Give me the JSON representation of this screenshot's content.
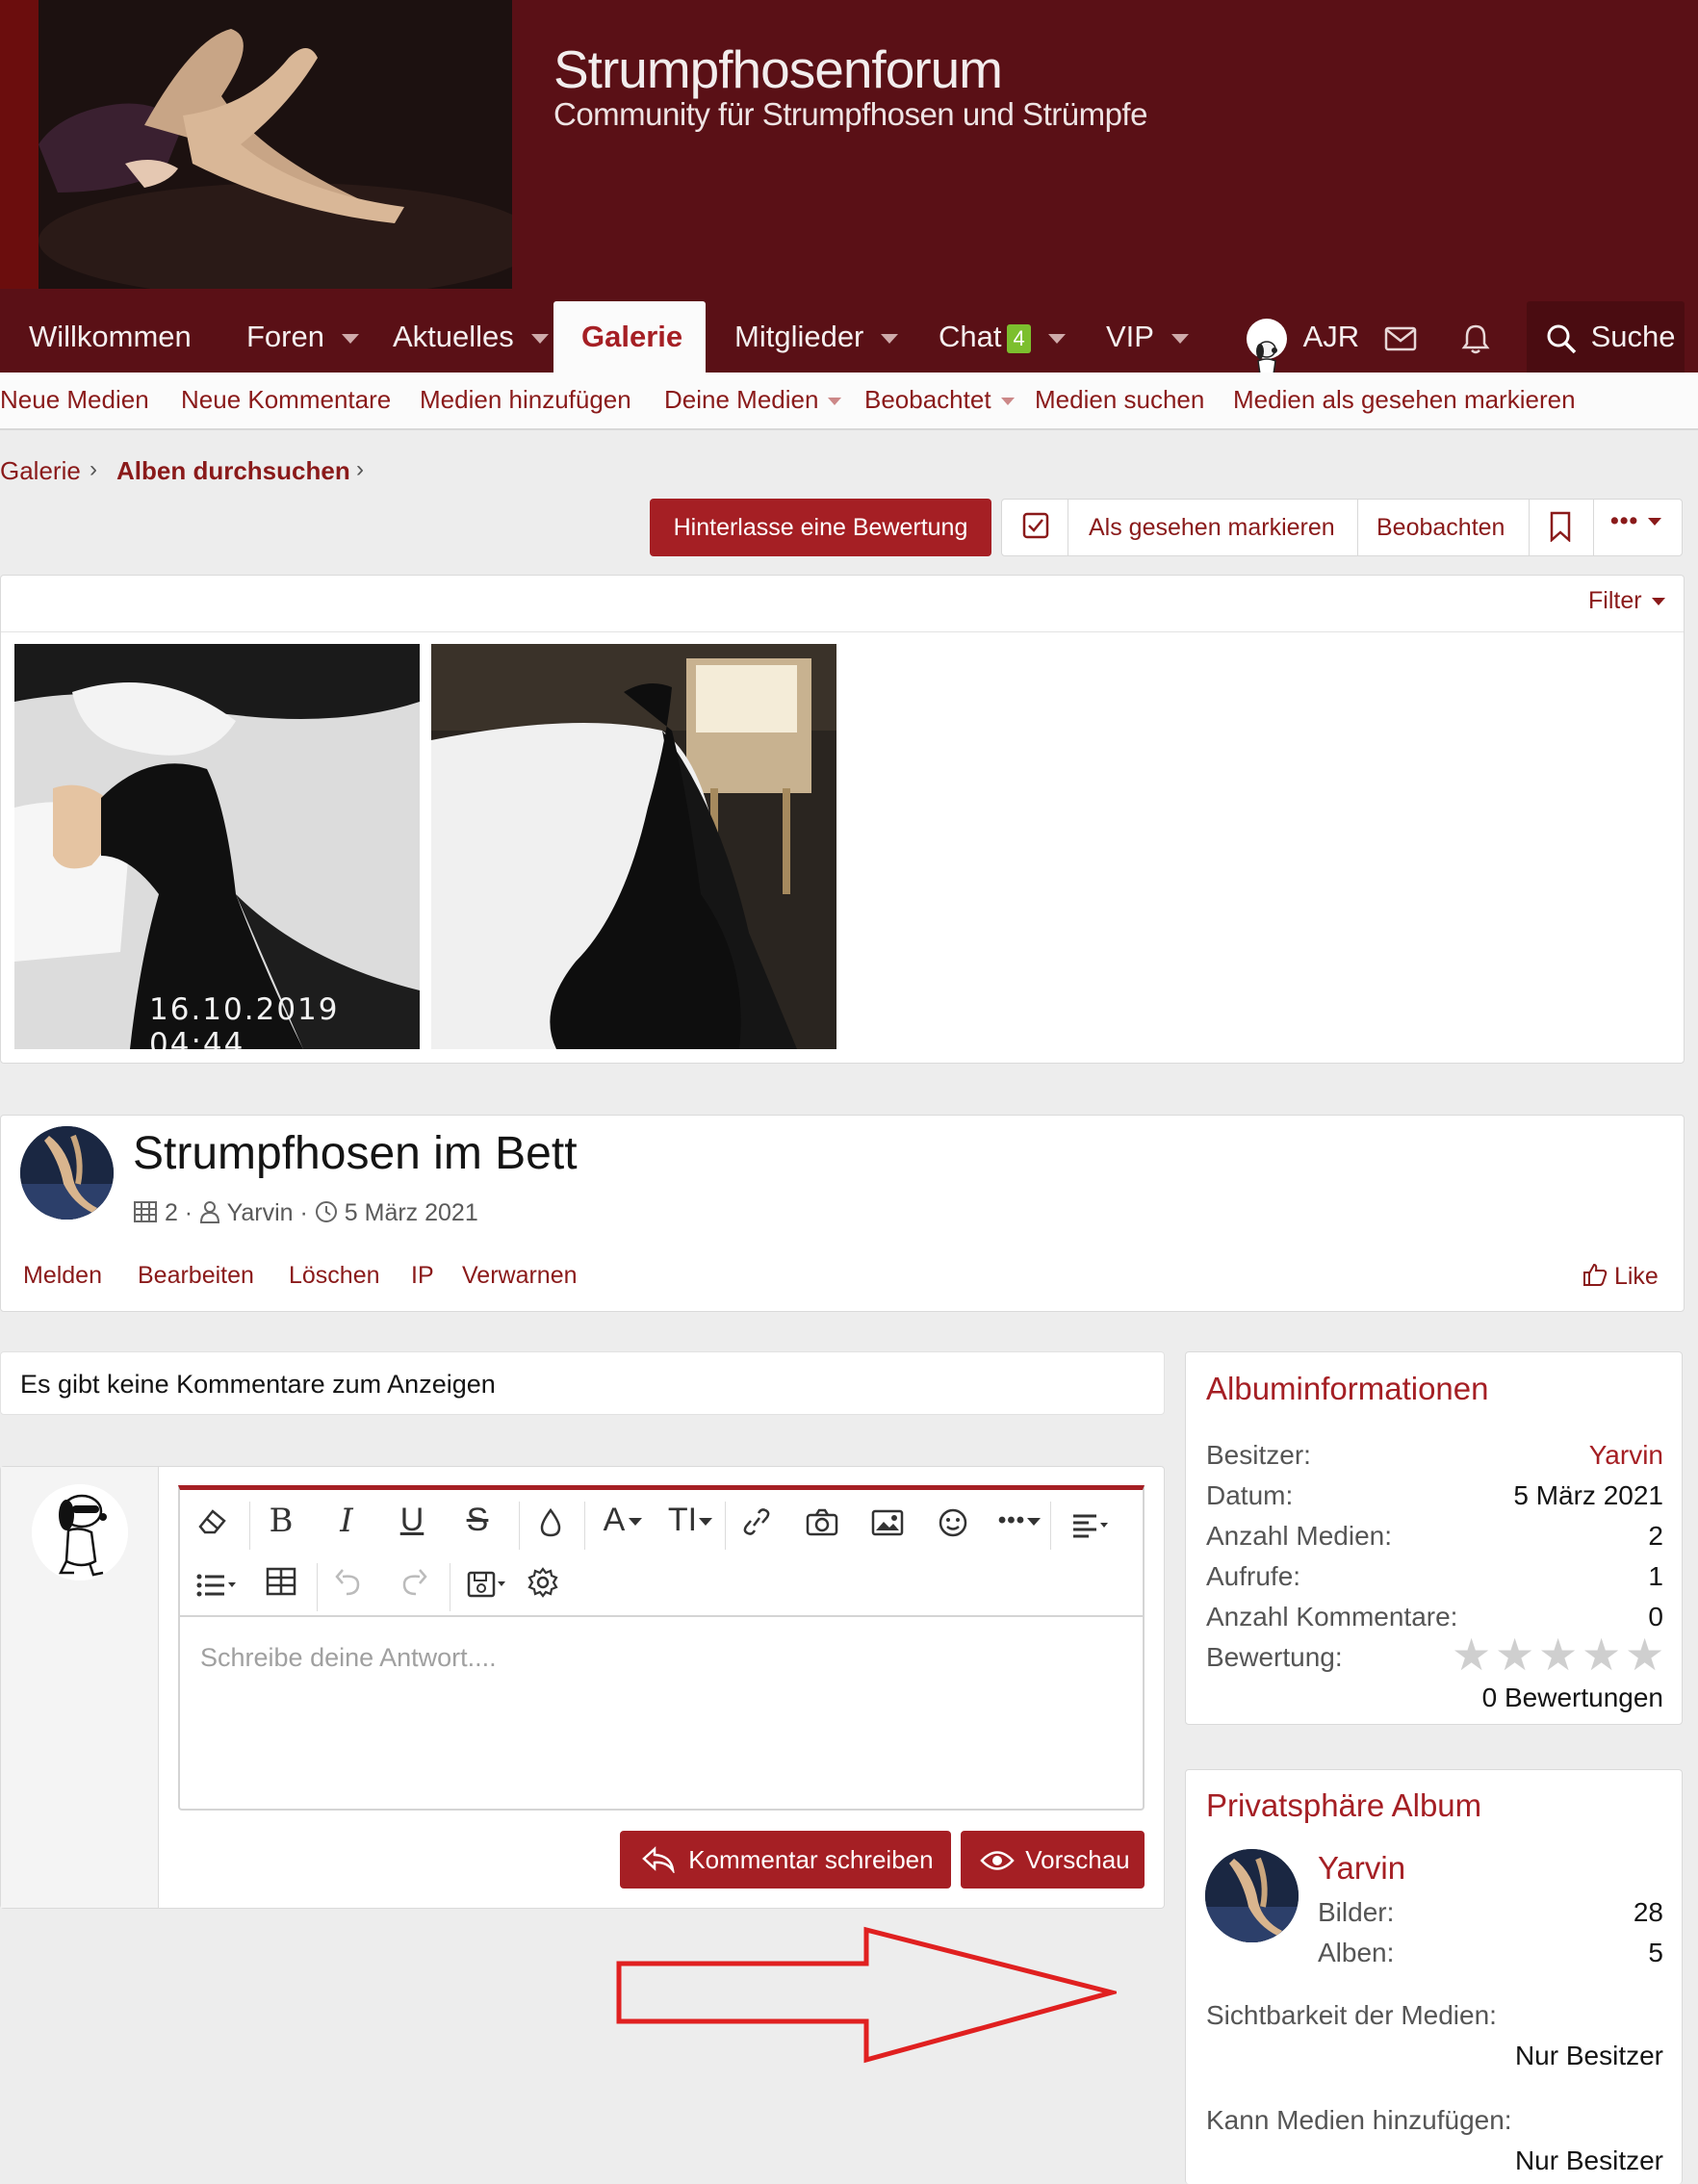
{
  "site": {
    "title": "Strumpfhosenforum",
    "subtitle": "Community für Strumpfhosen und Strümpfe"
  },
  "nav": {
    "items": [
      {
        "label": "Willkommen"
      },
      {
        "label": "Foren"
      },
      {
        "label": "Aktuelles"
      },
      {
        "label": "Galerie"
      },
      {
        "label": "Mitglieder"
      },
      {
        "label": "Chat",
        "badge": "4"
      },
      {
        "label": "VIP"
      }
    ],
    "user": "AJR",
    "search": "Suche"
  },
  "subnav": {
    "items": [
      {
        "label": "Neue Medien"
      },
      {
        "label": "Neue Kommentare"
      },
      {
        "label": "Medien hinzufügen"
      },
      {
        "label": "Deine Medien"
      },
      {
        "label": "Beobachtet"
      },
      {
        "label": "Medien suchen"
      },
      {
        "label": "Medien als gesehen markieren"
      }
    ]
  },
  "breadcrumb": {
    "items": [
      "Galerie",
      "Alben durchsuchen"
    ]
  },
  "actions": {
    "rate": "Hinterlasse eine Bewertung",
    "mark_seen": "Als gesehen markieren",
    "watch": "Beobachten"
  },
  "media": {
    "filter": "Filter",
    "thumb_timestamp": "16.10.2019 04:44"
  },
  "album": {
    "title": "Strumpfhosen im Bett",
    "count": "2",
    "author": "Yarvin",
    "date": "5 März 2021",
    "links": [
      "Melden",
      "Bearbeiten",
      "Löschen",
      "IP",
      "Verwarnen"
    ],
    "like": "Like"
  },
  "comments": {
    "empty": "Es gibt keine Kommentare zum Anzeigen",
    "placeholder": "Schreibe deine Antwort....",
    "submit": "Kommentar schreiben",
    "preview": "Vorschau"
  },
  "album_info": {
    "title": "Albuminformationen",
    "rows": [
      {
        "k": "Besitzer:",
        "v": "Yarvin"
      },
      {
        "k": "Datum:",
        "v": "5 März 2021"
      },
      {
        "k": "Anzahl Medien:",
        "v": "2"
      },
      {
        "k": "Aufrufe:",
        "v": "1"
      },
      {
        "k": "Anzahl Kommentare:",
        "v": "0"
      },
      {
        "k": "Bewertung:",
        "v": ""
      }
    ],
    "rating_count": "0 Bewertungen",
    "rating_stars": 0
  },
  "privacy": {
    "title": "Privatsphäre Album",
    "user": "Yarvin",
    "images_label": "Bilder:",
    "images": "28",
    "albums_label": "Alben:",
    "albums": "5",
    "visibility_label": "Sichtbarkeit der Medien:",
    "visibility": "Nur Besitzer",
    "add_label": "Kann Medien hinzufügen:",
    "add": "Nur Besitzer"
  },
  "colors": {
    "brand": "#5a1016",
    "accent": "#a51f24",
    "link": "#8a1a1a"
  }
}
